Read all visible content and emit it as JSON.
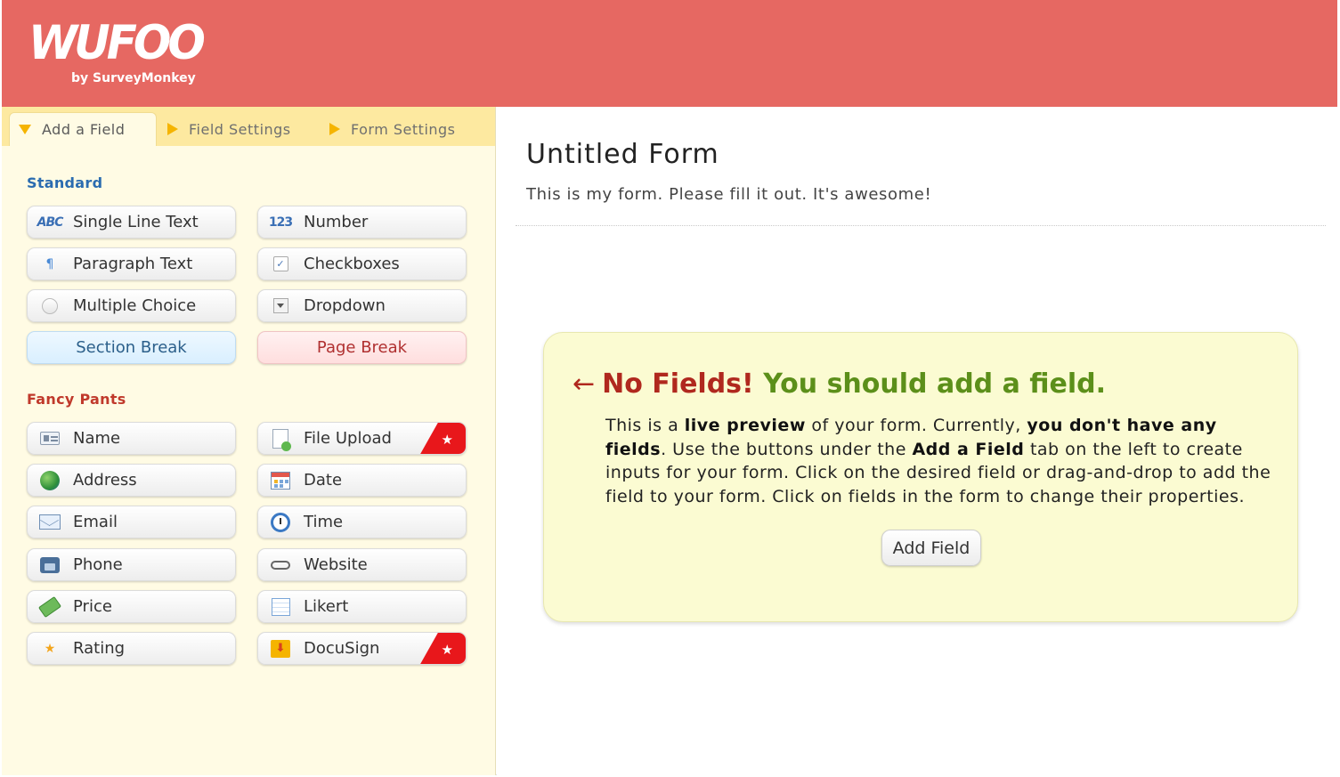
{
  "header": {
    "logo_text": "WUFOO",
    "logo_subtext": "by SurveyMonkey",
    "background_color": "#e66862"
  },
  "tabs": [
    {
      "label": "Add a Field",
      "active": true
    },
    {
      "label": "Field Settings",
      "active": false
    },
    {
      "label": "Form Settings",
      "active": false
    }
  ],
  "standard": {
    "title": "Standard",
    "fields": [
      {
        "label": "Single Line Text",
        "icon": "abc-icon"
      },
      {
        "label": "Number",
        "icon": "number-123-icon"
      },
      {
        "label": "Paragraph Text",
        "icon": "paragraph-icon"
      },
      {
        "label": "Checkboxes",
        "icon": "checkbox-icon"
      },
      {
        "label": "Multiple Choice",
        "icon": "radio-icon"
      },
      {
        "label": "Dropdown",
        "icon": "dropdown-icon"
      },
      {
        "label": "Section Break",
        "icon": ""
      },
      {
        "label": "Page Break",
        "icon": ""
      }
    ],
    "abc_glyph": "ABC",
    "num_glyph": "123",
    "para_glyph": "¶",
    "check_glyph": "✓"
  },
  "fancy": {
    "title": "Fancy Pants",
    "fields": [
      {
        "label": "Name",
        "icon": "name-card-icon"
      },
      {
        "label": "File Upload",
        "icon": "file-upload-icon",
        "premium": true
      },
      {
        "label": "Address",
        "icon": "globe-icon"
      },
      {
        "label": "Date",
        "icon": "calendar-icon"
      },
      {
        "label": "Email",
        "icon": "envelope-icon"
      },
      {
        "label": "Time",
        "icon": "clock-icon"
      },
      {
        "label": "Phone",
        "icon": "phone-icon"
      },
      {
        "label": "Website",
        "icon": "link-icon"
      },
      {
        "label": "Price",
        "icon": "money-icon"
      },
      {
        "label": "Likert",
        "icon": "grid-icon"
      },
      {
        "label": "Rating",
        "icon": "star-icon"
      },
      {
        "label": "DocuSign",
        "icon": "docusign-icon",
        "premium": true
      }
    ],
    "premium_glyph": "★",
    "star_glyph": "★",
    "docu_glyph": "⬇"
  },
  "form": {
    "title": "Untitled Form",
    "description": "This is my form. Please fill it out. It's awesome!"
  },
  "notice": {
    "arrow": "←",
    "headline_red": "No Fields!",
    "headline_green": "You should add a field.",
    "body_parts": [
      "This is a ",
      "live preview",
      " of your form. Currently, ",
      "you don't have any fields",
      ". Use the buttons under the ",
      "Add a Field",
      " tab on the left to create inputs for your form. Click on the desired field or drag-and-drop to add the field to your form. Click on fields in the form to change their properties."
    ],
    "button_label": "Add Field"
  }
}
